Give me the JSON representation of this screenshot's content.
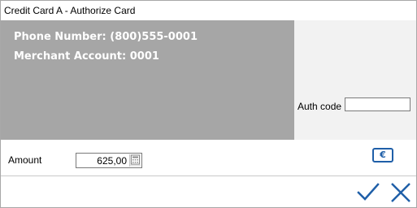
{
  "window": {
    "title": "Credit Card A - Authorize Card"
  },
  "info_panel": {
    "phone_line": "Phone Number: (800)555-0001",
    "merchant_line": "Merchant Account: 0001",
    "background_color": "#a6a6a6",
    "text_color": "#ffffff"
  },
  "auth": {
    "label": "Auth code",
    "value": ""
  },
  "amount": {
    "label": "Amount",
    "value": "625,00",
    "icon": "calculator-icon"
  },
  "currency_button": {
    "icon": "euro-icon",
    "symbol": "€",
    "color": "#1f5fa8"
  },
  "actions": {
    "ok_icon": "checkmark-icon",
    "cancel_icon": "close-icon",
    "accent_color": "#1f5fa8"
  }
}
